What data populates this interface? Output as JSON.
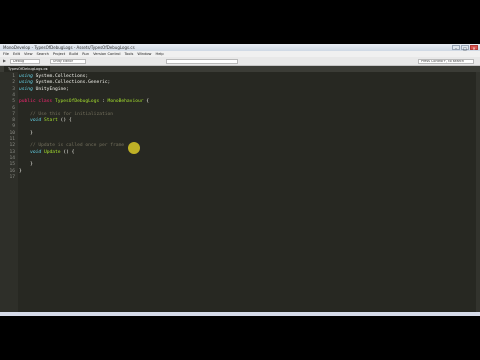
{
  "window": {
    "title": "MonoDevelop - TypesOfDebugLogs - Assets/TypesOfDebugLogs.cs",
    "controls": [
      "–",
      "□",
      "✕"
    ]
  },
  "menu": [
    "File",
    "Edit",
    "View",
    "Search",
    "Project",
    "Build",
    "Run",
    "Version Control",
    "Tools",
    "Window",
    "Help"
  ],
  "toolbar": {
    "config": "Debug",
    "target": "Unity Editor",
    "search_placeholder": "Press Control+, to search"
  },
  "tab": {
    "label": "TypesOfDebugLogs.cs",
    "close": "×"
  },
  "code_lines": [
    {
      "n": "1",
      "parts": [
        {
          "t": "using",
          "c": "kw"
        },
        {
          "t": " System.Collections;",
          "c": ""
        }
      ]
    },
    {
      "n": "2",
      "parts": [
        {
          "t": "using",
          "c": "kw"
        },
        {
          "t": " System.Collections.Generic;",
          "c": ""
        }
      ]
    },
    {
      "n": "3",
      "parts": [
        {
          "t": "using",
          "c": "kw"
        },
        {
          "t": " UnityEngine;",
          "c": ""
        }
      ]
    },
    {
      "n": "4",
      "parts": []
    },
    {
      "n": "5",
      "parts": [
        {
          "t": "public class ",
          "c": "kw2"
        },
        {
          "t": "TypesOfDebugLogs",
          "c": "cls"
        },
        {
          "t": " : ",
          "c": ""
        },
        {
          "t": "MonoBehaviour",
          "c": "cls"
        },
        {
          "t": " {",
          "c": ""
        }
      ]
    },
    {
      "n": "6",
      "parts": []
    },
    {
      "n": "7",
      "parts": [
        {
          "t": "    // Use this for initialization",
          "c": "cm"
        }
      ]
    },
    {
      "n": "8",
      "parts": [
        {
          "t": "    ",
          "c": ""
        },
        {
          "t": "void",
          "c": "kw"
        },
        {
          "t": " ",
          "c": ""
        },
        {
          "t": "Start",
          "c": "cls"
        },
        {
          "t": " () {",
          "c": ""
        }
      ]
    },
    {
      "n": "9",
      "parts": [
        {
          "t": "        ",
          "c": ""
        }
      ]
    },
    {
      "n": "10",
      "parts": [
        {
          "t": "    }",
          "c": ""
        }
      ]
    },
    {
      "n": "11",
      "parts": []
    },
    {
      "n": "12",
      "parts": [
        {
          "t": "    // Update is called once per frame",
          "c": "cm"
        }
      ]
    },
    {
      "n": "13",
      "parts": [
        {
          "t": "    ",
          "c": ""
        },
        {
          "t": "void",
          "c": "kw"
        },
        {
          "t": " ",
          "c": ""
        },
        {
          "t": "Update",
          "c": "cls"
        },
        {
          "t": " () {",
          "c": ""
        }
      ]
    },
    {
      "n": "14",
      "parts": [
        {
          "t": "        ",
          "c": ""
        }
      ]
    },
    {
      "n": "15",
      "parts": [
        {
          "t": "    }",
          "c": ""
        }
      ]
    },
    {
      "n": "16",
      "parts": [
        {
          "t": "}",
          "c": ""
        }
      ]
    },
    {
      "n": "17",
      "parts": []
    }
  ]
}
